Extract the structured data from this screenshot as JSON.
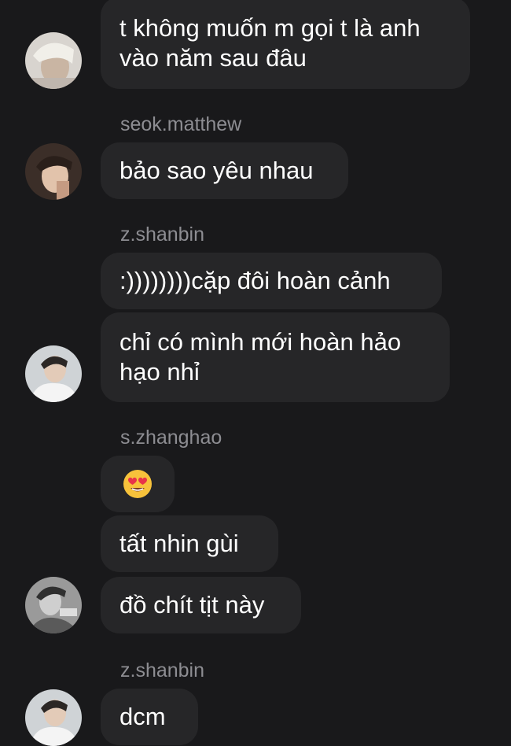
{
  "messages": [
    {
      "text": "t không muốn m gọi t là anh vào năm sau đâu"
    },
    {
      "sender": "seok.matthew",
      "text": "bảo sao yêu nhau"
    },
    {
      "sender": "z.shanbin",
      "text": ":))))))))cặp đôi hoàn cảnh"
    },
    {
      "text": "chỉ có mình mới hoàn hảo hạo nhỉ"
    },
    {
      "sender": "s.zhanghao",
      "emoji": "smiling-face-with-heart-eyes"
    },
    {
      "text": "tất nhin gùi"
    },
    {
      "text": "đồ chít tịt này"
    },
    {
      "sender": "z.shanbin",
      "text": "dcm"
    }
  ],
  "colors": {
    "background": "#19191b",
    "bubble": "#262628",
    "text": "#ffffff",
    "sender": "#8d8d92"
  }
}
